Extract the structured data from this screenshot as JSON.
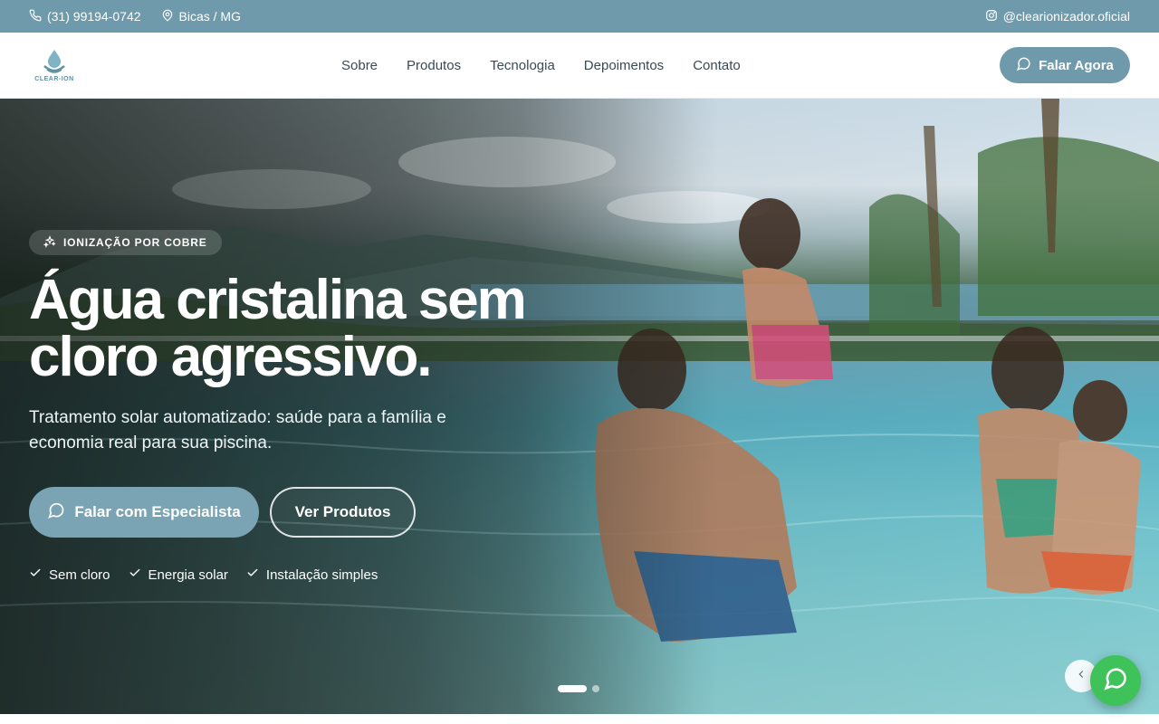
{
  "topbar": {
    "phone": "(31) 99194-0742",
    "location": "Bicas / MG",
    "instagram": "@clearionizador.oficial"
  },
  "brand": {
    "logo_text": "CLEAR-ION"
  },
  "nav": {
    "items": [
      "Sobre",
      "Produtos",
      "Tecnologia",
      "Depoimentos",
      "Contato"
    ],
    "cta_label": "Falar Agora"
  },
  "hero": {
    "badge": "IONIZAÇÃO POR COBRE",
    "title_line1": "Água cristalina sem",
    "title_line2": "cloro agressivo.",
    "subtitle": "Tratamento solar automatizado: saúde para a família e economia real para sua piscina.",
    "primary_button": "Falar com Especialista",
    "secondary_button": "Ver Produtos",
    "features": [
      "Sem cloro",
      "Energia solar",
      "Instalação simples"
    ]
  },
  "carousel": {
    "slide_count": 2,
    "active_slide": 1
  },
  "colors": {
    "brand": "#6f9aab",
    "whatsapp": "#3fc25a"
  },
  "icons": {
    "phone": "phone-icon",
    "location": "map-pin-icon",
    "instagram": "instagram-icon",
    "chat": "chat-bubble-icon",
    "sparkles": "sparkles-icon",
    "check": "check-icon",
    "prev": "chevron-left-icon",
    "whatsapp": "whatsapp-icon"
  }
}
